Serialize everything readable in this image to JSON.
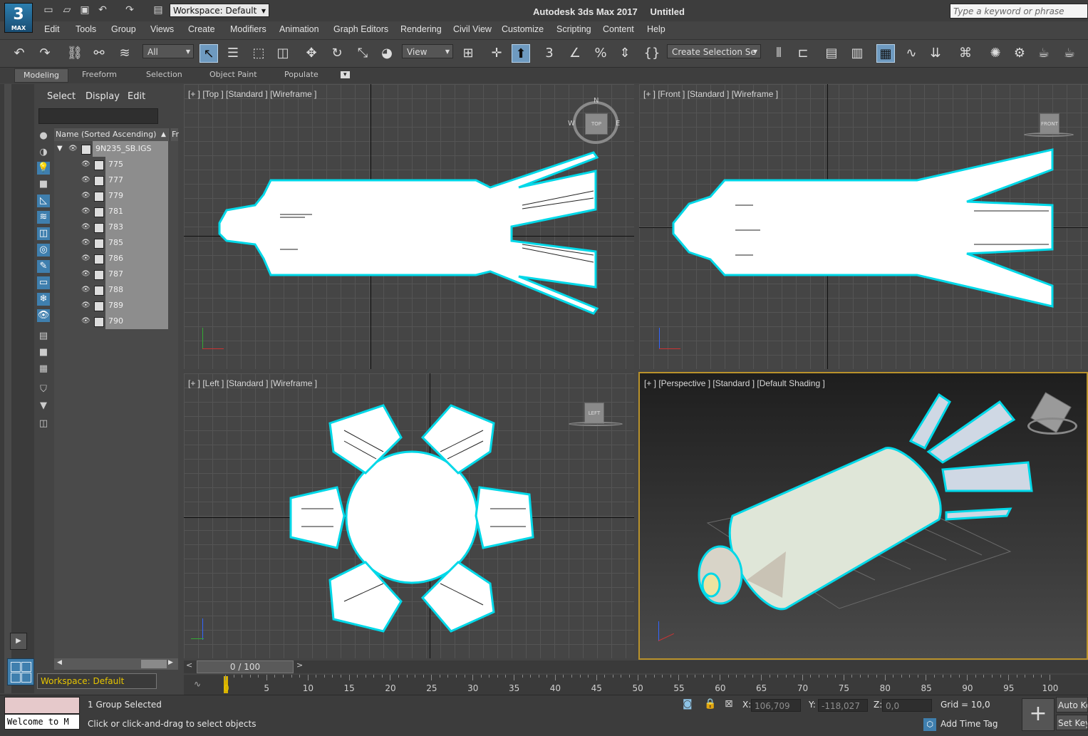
{
  "window": {
    "app_title": "Autodesk 3ds Max 2017",
    "document_title": "Untitled",
    "logo_number": "3",
    "logo_text": "MAX",
    "workspace": "Workspace: Default",
    "search_placeholder": "Type a keyword or phrase"
  },
  "menu": [
    "Edit",
    "Tools",
    "Group",
    "Views",
    "Create",
    "Modifiers",
    "Animation",
    "Graph Editors",
    "Rendering",
    "Civil View",
    "Customize",
    "Scripting",
    "Content",
    "Help"
  ],
  "toolbar": {
    "selection_filter": "All",
    "reference_coord": "View",
    "named_selection": "Create Selection Se"
  },
  "ribbon_tabs": [
    "Modeling",
    "Freeform",
    "Selection",
    "Object Paint",
    "Populate"
  ],
  "explorer": {
    "tabs": [
      "Select",
      "Display",
      "Edit"
    ],
    "column_header": "Name (Sorted Ascending)",
    "column_header_2": "Fr",
    "root": "9N235_SB.IGS",
    "children": [
      "775",
      "777",
      "779",
      "781",
      "783",
      "785",
      "786",
      "787",
      "788",
      "789",
      "790"
    ],
    "bottom_workspace": "Workspace: Default"
  },
  "viewports": {
    "top": {
      "label": "[+ ] [Top ] [Standard ] [Wireframe ]",
      "cube": "TOP",
      "compass_n": "N",
      "compass_w": "W",
      "compass_e": "E"
    },
    "front": {
      "label": "[+ ] [Front ] [Standard ] [Wireframe ]",
      "cube": "FRONT"
    },
    "left": {
      "label": "[+ ] [Left ] [Standard ] [Wireframe ]",
      "cube": "LEFT"
    },
    "perspective": {
      "label": "[+ ] [Perspective ] [Standard ] [Default Shading ]"
    }
  },
  "timeline": {
    "frame_display": "0 / 100",
    "ticks": [
      "0",
      "5",
      "10",
      "15",
      "20",
      "25",
      "30",
      "35",
      "40",
      "45",
      "50",
      "55",
      "60",
      "65",
      "70",
      "75",
      "80",
      "85",
      "90",
      "95",
      "100"
    ]
  },
  "status": {
    "maxscript_text": "Welcome to M",
    "selection": "1 Group Selected",
    "prompt": "Click or click-and-drag to select objects",
    "x_label": "X:",
    "x_value": "106,709",
    "y_label": "Y:",
    "y_value": "-118,027",
    "z_label": "Z:",
    "z_value": "0,0",
    "grid": "Grid = 10,0",
    "auto_key": "Auto Ke",
    "set_key": "Set Key",
    "add_time_tag": "Add Time Tag"
  },
  "colors": {
    "selection_outline": "#00d8e8",
    "active_viewport_border": "#b9922b",
    "workspace_text": "#e7c500"
  }
}
